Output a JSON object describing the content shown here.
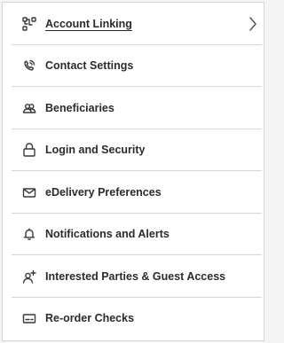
{
  "menu": {
    "items": [
      {
        "label": "Account Linking",
        "icon": "account-linking-icon",
        "active": true
      },
      {
        "label": "Contact Settings",
        "icon": "phone-icon"
      },
      {
        "label": "Beneficiaries",
        "icon": "people-icon"
      },
      {
        "label": "Login and Security",
        "icon": "lock-icon"
      },
      {
        "label": "eDelivery Preferences",
        "icon": "envelope-icon"
      },
      {
        "label": "Notifications and Alerts",
        "icon": "bell-icon"
      },
      {
        "label": "Interested Parties & Guest Access",
        "icon": "add-person-icon"
      },
      {
        "label": "Re-order Checks",
        "icon": "check-icon"
      }
    ]
  },
  "colors": {
    "text": "#2b2b2b",
    "divider": "#d7d7d7",
    "icon": "#3a3a3a"
  }
}
